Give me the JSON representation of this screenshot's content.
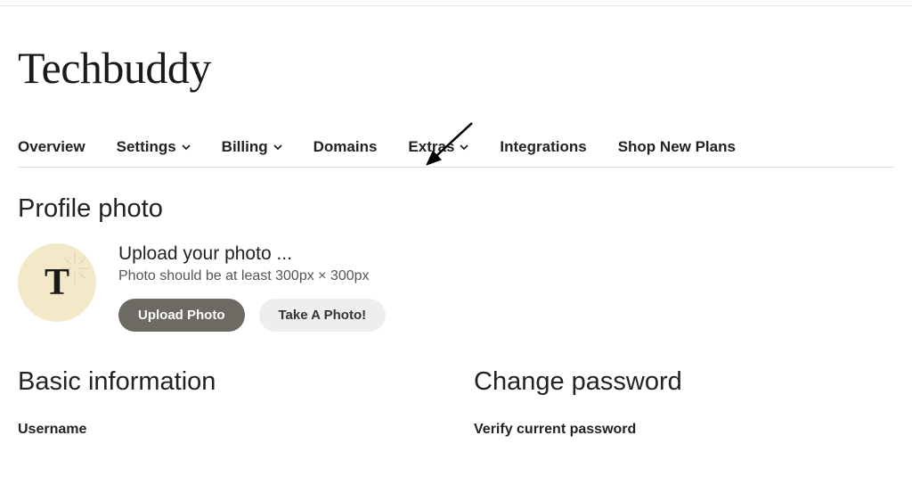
{
  "header": {
    "title": "Techbuddy"
  },
  "nav": {
    "items": [
      {
        "label": "Overview",
        "hasDropdown": false
      },
      {
        "label": "Settings",
        "hasDropdown": true
      },
      {
        "label": "Billing",
        "hasDropdown": true
      },
      {
        "label": "Domains",
        "hasDropdown": false
      },
      {
        "label": "Extras",
        "hasDropdown": true
      },
      {
        "label": "Integrations",
        "hasDropdown": false
      },
      {
        "label": "Shop New Plans",
        "hasDropdown": false
      }
    ]
  },
  "profile": {
    "heading": "Profile photo",
    "avatarLetter": "T",
    "uploadTitle": "Upload your photo ...",
    "uploadDesc": "Photo should be at least 300px × 300px",
    "uploadBtn": "Upload Photo",
    "takeBtn": "Take A Photo!"
  },
  "basic": {
    "heading": "Basic information",
    "usernameLabel": "Username"
  },
  "password": {
    "heading": "Change password",
    "verifyLabel": "Verify current password"
  }
}
